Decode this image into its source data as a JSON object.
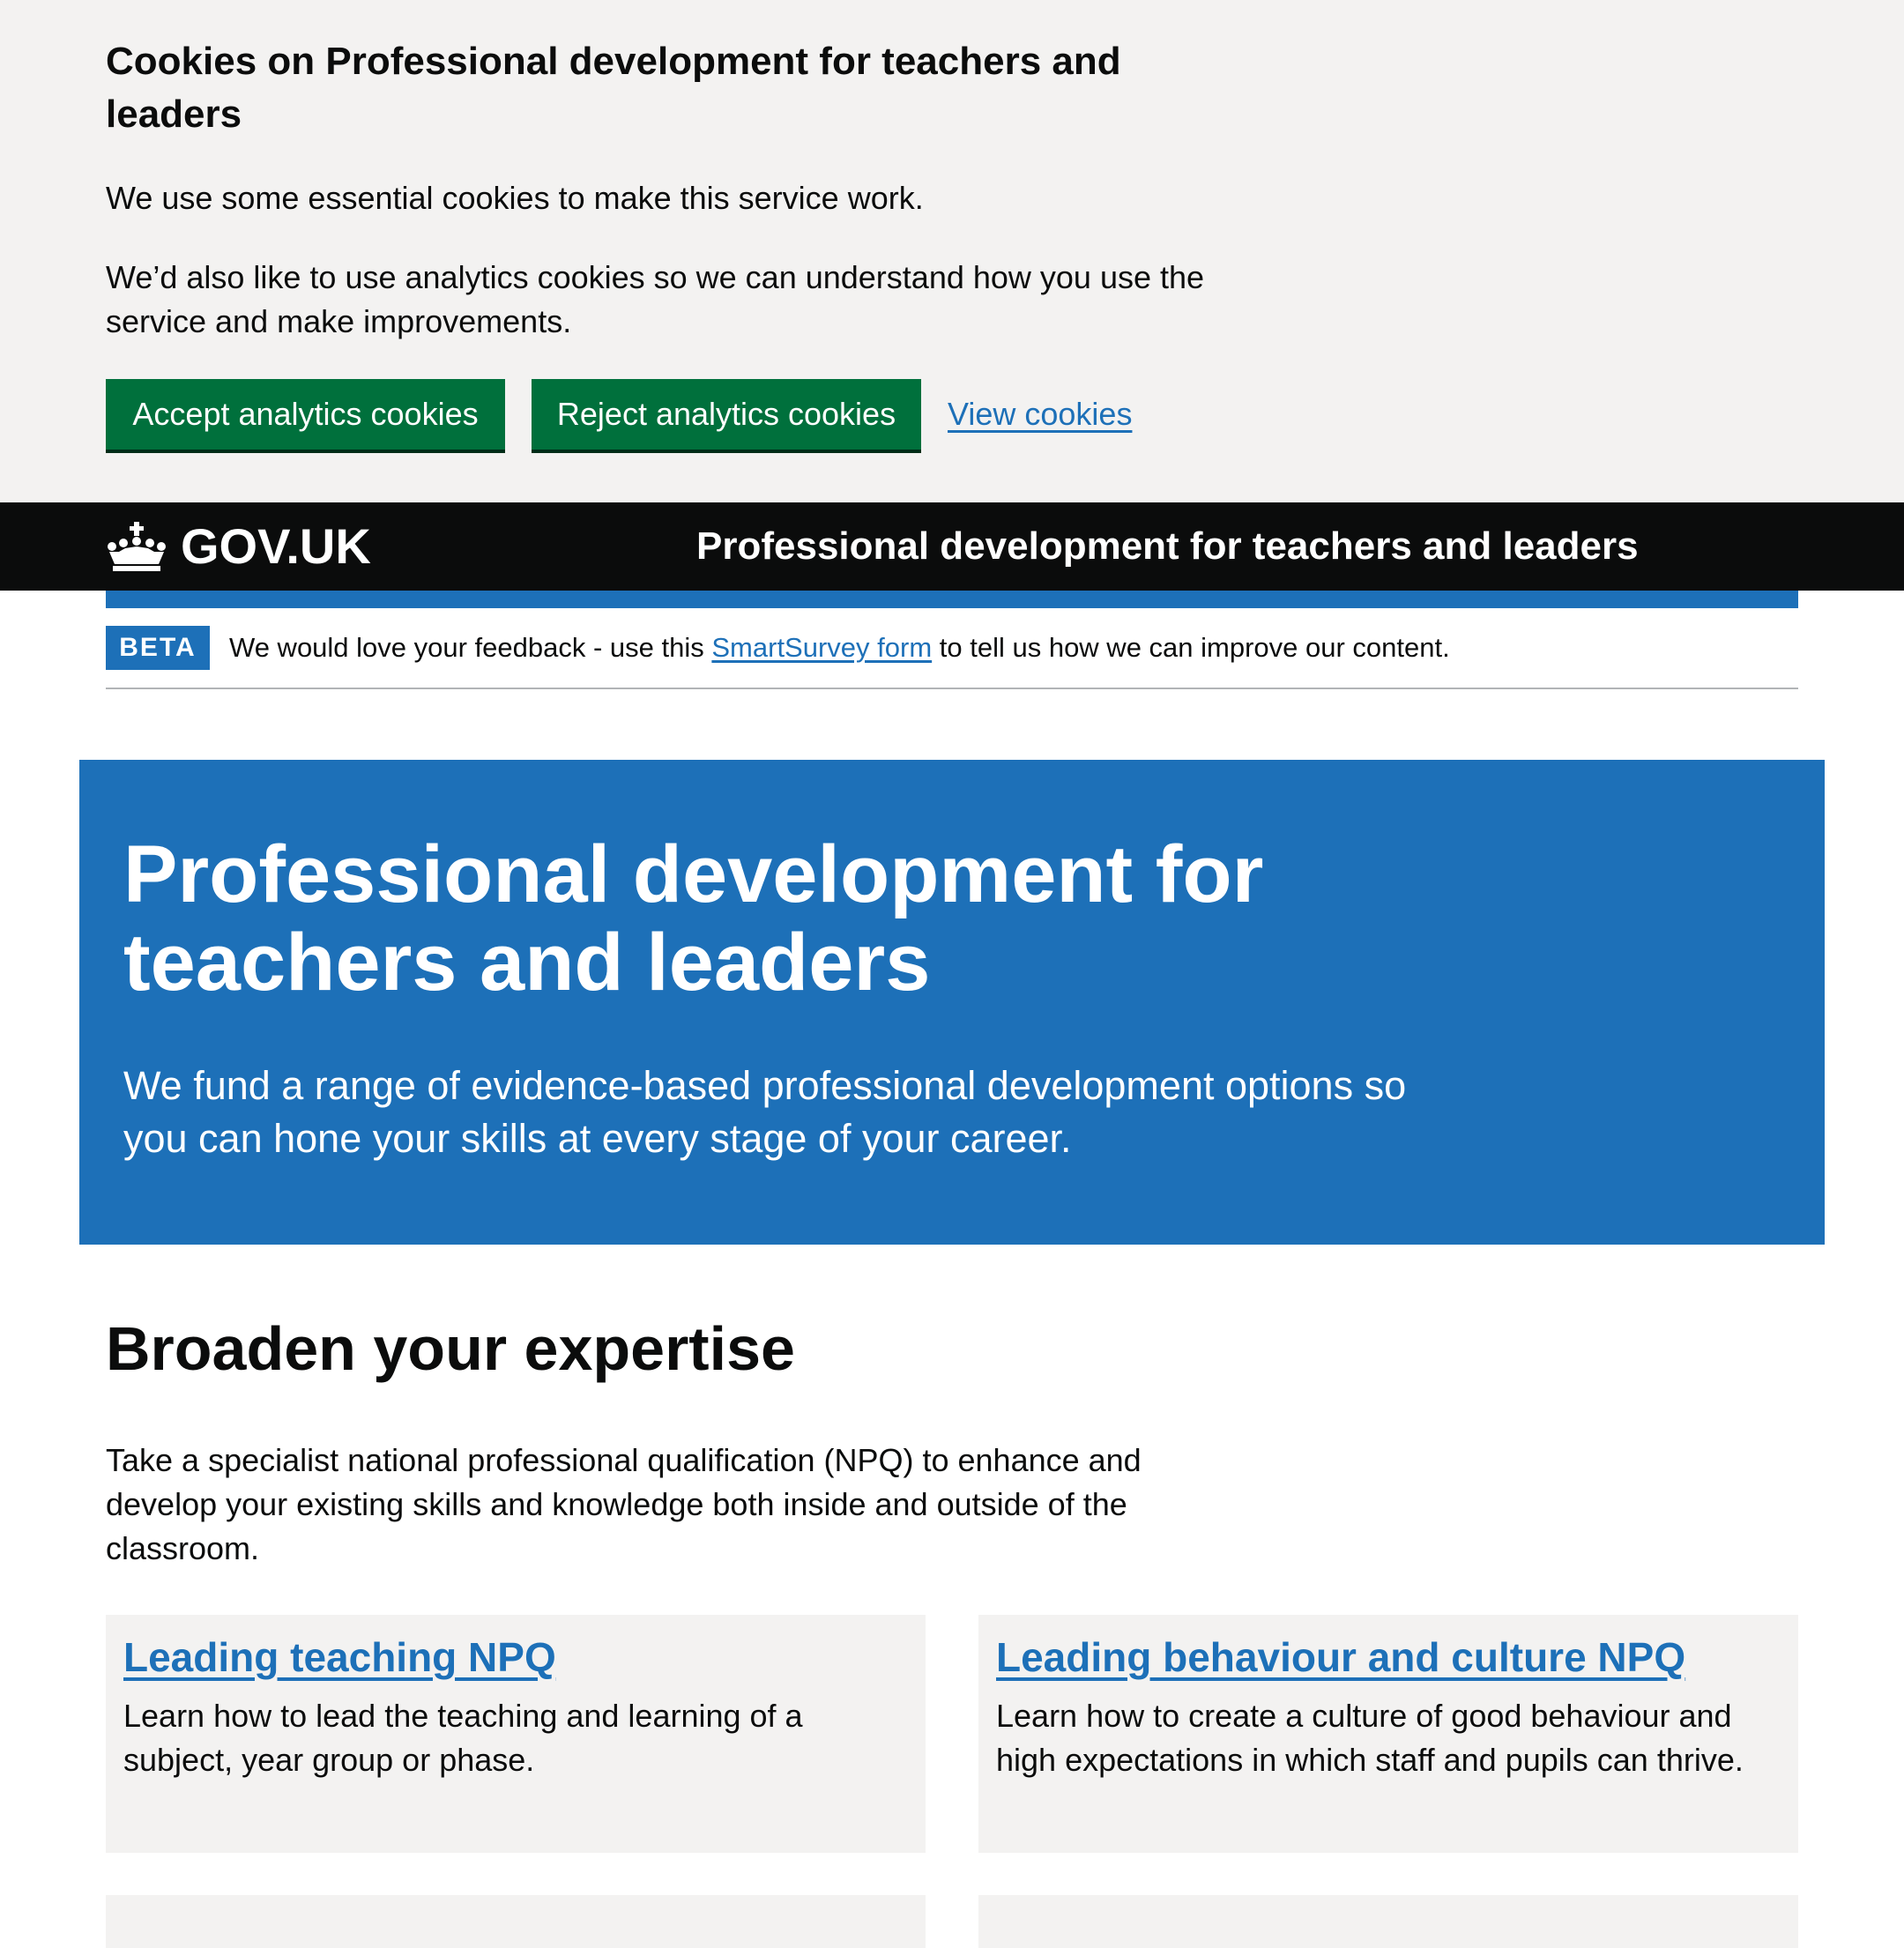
{
  "cookie_banner": {
    "title": "Cookies on Professional development for teachers and leaders",
    "paragraph1": "We use some essential cookies to make this service work.",
    "paragraph2": "We’d also like to use analytics cookies so we can understand how you use the service and make improvements.",
    "accept_label": "Accept analytics cookies",
    "reject_label": "Reject analytics cookies",
    "view_link": "View cookies"
  },
  "header": {
    "logo_text": "GOV.UK",
    "logo_icon": "crown-icon",
    "service_name": "Professional development for teachers and leaders"
  },
  "phase_banner": {
    "tag": "BETA",
    "text_before": "We would love your feedback - use this ",
    "link_text": "SmartSurvey form",
    "text_after": " to tell us how we can improve our content."
  },
  "hero": {
    "title": "Professional development for teachers and leaders",
    "description": "We fund a range of evidence-based professional development options so you can hone your skills at every stage of your career."
  },
  "section": {
    "title": "Broaden your expertise",
    "description": "Take a specialist national professional qualification (NPQ) to enhance and develop your existing skills and knowledge both inside and outside of the classroom.",
    "cards": [
      {
        "title": "Leading teaching NPQ",
        "text": "Learn how to lead the teaching and learning of a subject, year group or phase."
      },
      {
        "title": "Leading behaviour and culture NPQ",
        "text": "Learn how to create a culture of good behaviour and high expectations in which staff and pupils can thrive."
      }
    ]
  },
  "colors": {
    "brand_blue": "#1d70b8",
    "button_green": "#00703c",
    "header_black": "#0b0c0c",
    "banner_grey": "#f3f2f1"
  }
}
